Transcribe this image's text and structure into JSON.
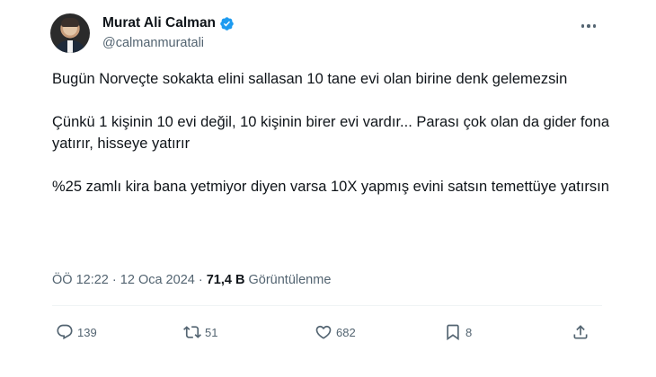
{
  "author": {
    "name": "Murat Ali Calman",
    "handle": "@calmanmuratali"
  },
  "tweet": {
    "paragraphs": [
      "Bugün Norveçte sokakta elini sallasan 10 tane evi olan birine denk gelemezsin",
      "Çünkü 1 kişinin 10 evi değil, 10 kişinin birer evi vardır... Parası çok olan da gider fona yatırır, hisseye yatırır",
      "%25 zamlı kira bana yetmiyor diyen varsa 10X yapmış evini satsın temettüye yatırsın"
    ],
    "time": "ÖÖ 12:22",
    "date": "12 Oca 2024",
    "separator": "·",
    "views_count": "71,4 B",
    "views_label": "Görüntülenme"
  },
  "actions": {
    "replies": "139",
    "retweets": "51",
    "likes": "682",
    "bookmarks": "8"
  },
  "colors": {
    "text": "#0f1419",
    "secondary": "#536471",
    "verified": "#1d9bf0",
    "divider": "#eff3f4"
  },
  "icons": [
    "verified-badge-icon",
    "more-options-icon",
    "reply-icon",
    "retweet-icon",
    "like-icon",
    "bookmark-icon",
    "share-icon"
  ]
}
